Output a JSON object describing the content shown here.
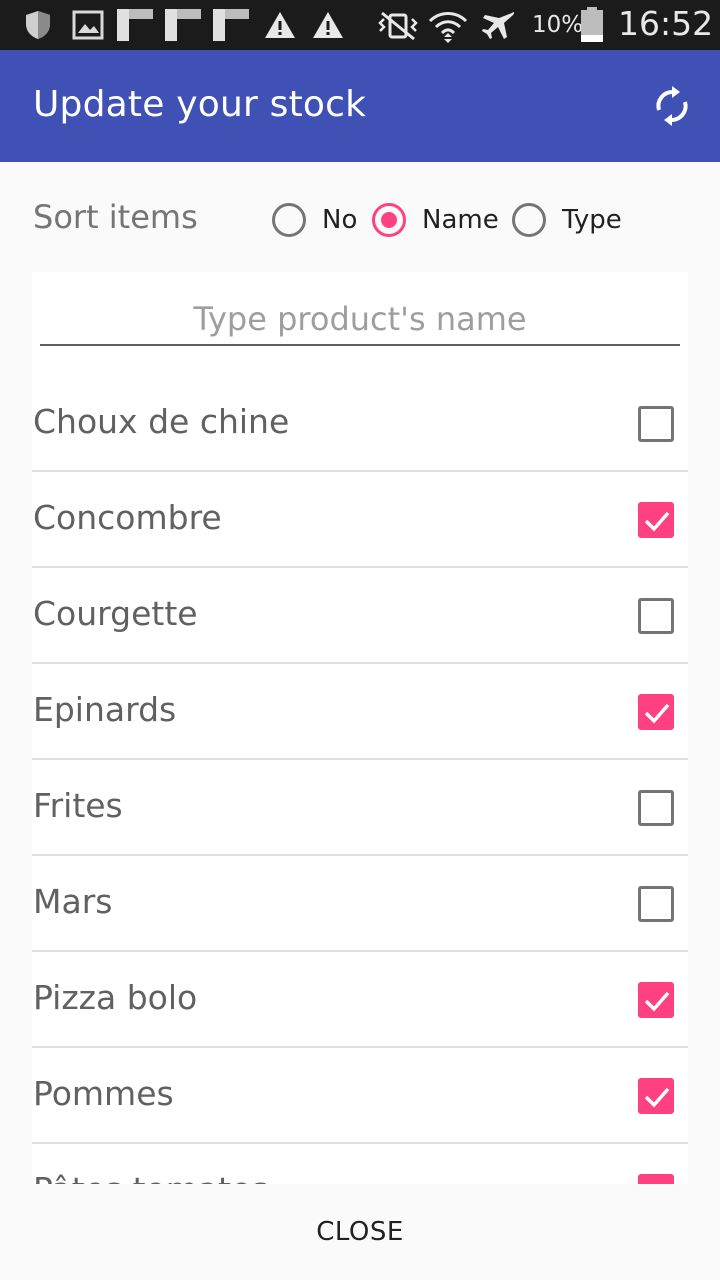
{
  "status_bar": {
    "battery_percent": "10%",
    "time": "16:52"
  },
  "app_bar": {
    "title": "Update your stock",
    "refresh_icon": "refresh-icon"
  },
  "sort": {
    "label": "Sort items",
    "options": [
      {
        "label": "No",
        "selected": false
      },
      {
        "label": "Name",
        "selected": true
      },
      {
        "label": "Type",
        "selected": false
      }
    ]
  },
  "search": {
    "placeholder": "Type product's name",
    "value": ""
  },
  "items": [
    {
      "name": "Choux de chine",
      "checked": false
    },
    {
      "name": "Concombre",
      "checked": true
    },
    {
      "name": "Courgette",
      "checked": false
    },
    {
      "name": "Epinards",
      "checked": true
    },
    {
      "name": "Frites",
      "checked": false
    },
    {
      "name": "Mars",
      "checked": false
    },
    {
      "name": "Pizza bolo",
      "checked": true
    },
    {
      "name": "Pommes",
      "checked": true
    },
    {
      "name": "Pâtes tomates",
      "checked": true
    }
  ],
  "footer": {
    "close_label": "CLOSE"
  },
  "colors": {
    "primary": "#3f51b5",
    "accent": "#ff4081"
  }
}
